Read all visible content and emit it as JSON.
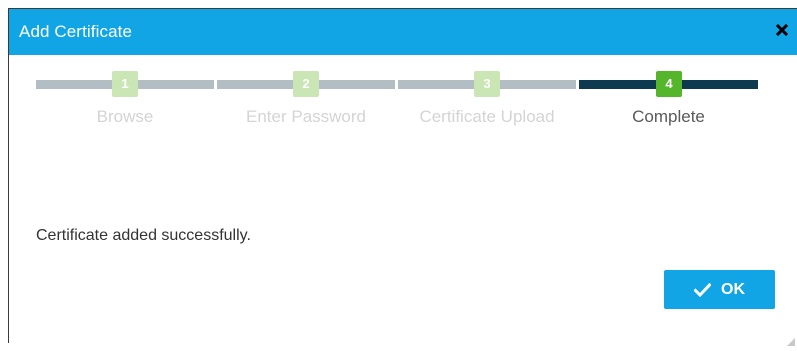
{
  "dialog": {
    "title": "Add Certificate",
    "close_icon": "close-icon"
  },
  "stepper": {
    "current_step": 4,
    "steps": [
      {
        "number": "1",
        "label": "Browse",
        "state": "done"
      },
      {
        "number": "2",
        "label": "Enter Password",
        "state": "done"
      },
      {
        "number": "3",
        "label": "Certificate Upload",
        "state": "done"
      },
      {
        "number": "4",
        "label": "Complete",
        "state": "active"
      }
    ]
  },
  "message": "Certificate added successfully.",
  "ok_button": {
    "label": "OK",
    "icon": "check-icon"
  },
  "colors": {
    "header": "#12a5e6",
    "step_done_bar": "#b3bec4",
    "step_active_bar": "#0d3a4f",
    "step_done_badge": "#c9e6b4",
    "step_active_badge": "#55b62b",
    "step_done_text": "#d4d4d4",
    "step_active_text": "#5a5a5a"
  }
}
